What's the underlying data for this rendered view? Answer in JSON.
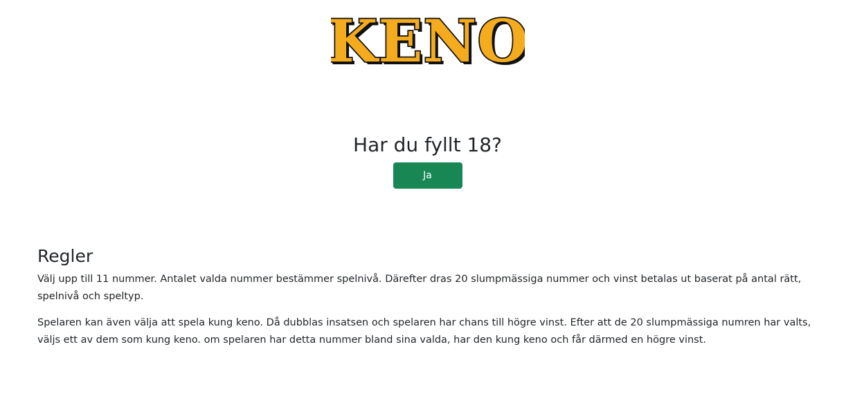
{
  "logo": {
    "text": "KENO",
    "fill_color": "#f5ab1e",
    "outline_color": "#111111"
  },
  "age_gate": {
    "question": "Har du fyllt 18?",
    "confirm_label": "Ja",
    "button_color": "#198754"
  },
  "rules": {
    "title": "Regler",
    "paragraphs": [
      "Välj upp till 11 nummer. Antalet valda nummer bestämmer spelnivå. Därefter dras 20 slumpmässiga nummer och vinst betalas ut baserat på antal rätt, spelnivå och speltyp.",
      "Spelaren kan även välja att spela kung keno. Då dubblas insatsen och spelaren har chans till högre vinst. Efter att de 20 slumpmässiga numren har valts, väljs ett av dem som kung keno. om spelaren har detta nummer bland sina valda, har den kung keno och får därmed en högre vinst."
    ]
  }
}
